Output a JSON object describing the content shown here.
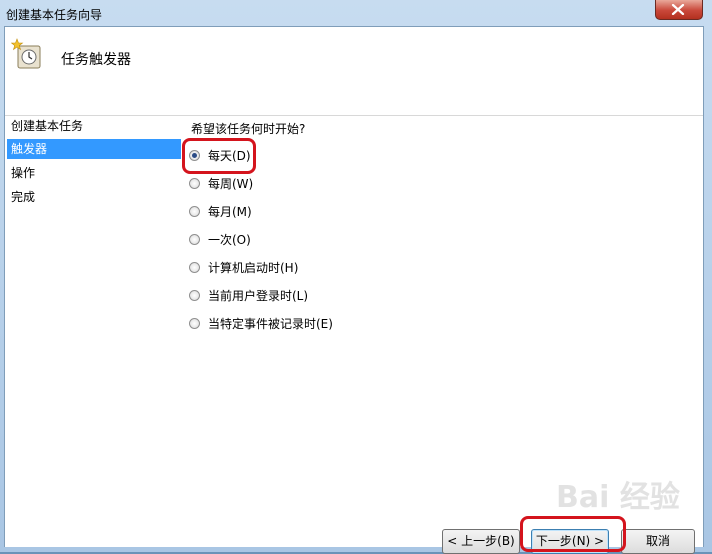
{
  "window": {
    "title": "创建基本任务向导"
  },
  "header": {
    "title": "任务触发器"
  },
  "sidebar": {
    "items": [
      {
        "label": "创建基本任务"
      },
      {
        "label": "触发器"
      },
      {
        "label": "操作"
      },
      {
        "label": "完成"
      }
    ]
  },
  "main": {
    "question": "希望该任务何时开始?",
    "options": [
      {
        "label": "每天(D)",
        "checked": true
      },
      {
        "label": "每周(W)",
        "checked": false
      },
      {
        "label": "每月(M)",
        "checked": false
      },
      {
        "label": "一次(O)",
        "checked": false
      },
      {
        "label": "计算机启动时(H)",
        "checked": false
      },
      {
        "label": "当前用户登录时(L)",
        "checked": false
      },
      {
        "label": "当特定事件被记录时(E)",
        "checked": false
      }
    ]
  },
  "footer": {
    "back_label": "< 上一步(B)",
    "next_label": "下一步(N) >",
    "cancel_label": "取消"
  },
  "watermark": "Bai 经验",
  "colors": {
    "accent": "#3399ff",
    "highlight": "#d4141d"
  }
}
